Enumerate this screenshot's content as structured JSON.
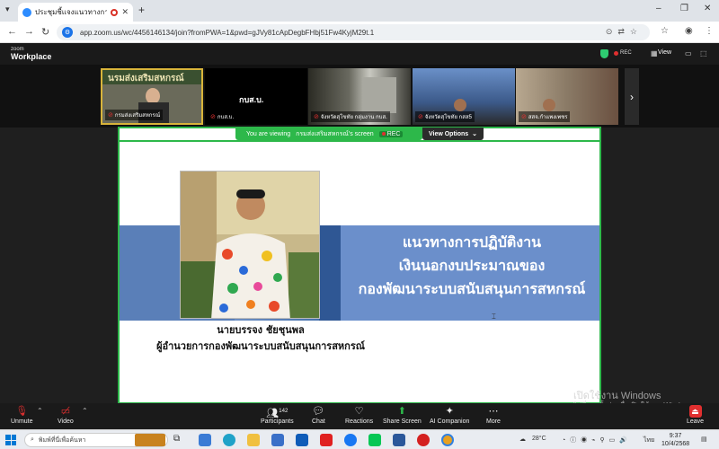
{
  "browser": {
    "tab_title": "ประชุมชี้แจงแนวทางการปฏิบัติงาน",
    "new_tab": "+",
    "url": "app.zoom.us/wc/4456146134/join?fromPWA=1&pwd=gJVy81cApDegbFHbj51Fw4KyjM29t.1"
  },
  "zoom_header": {
    "logo_top": "zoom",
    "logo_bottom": "Workplace",
    "rec_label": "REC",
    "view_label": "View"
  },
  "participants": [
    {
      "name": "กรมส่งเสริมสหกรณ์",
      "bg": "#6a6a5a"
    },
    {
      "name": "กบส.บ.",
      "bg": "#000000"
    },
    {
      "name": "จังหวัดสุโขทัย กลุ่มงาน กบส.",
      "bg": "#3a3a34"
    },
    {
      "name": "จังหวัดสุโขทัย กสส5",
      "bg": "#3c5a8a"
    },
    {
      "name": "สสจ.กำแพงเพชร",
      "bg": "#8a7a66"
    }
  ],
  "share_bar": {
    "prefix": "You are viewing",
    "sharer": "กรมส่งเสริมสหกรณ์'s screen",
    "rec_label": "REC",
    "view_options": "View Options"
  },
  "slide": {
    "title_lines": [
      "แนวทางการปฏิบัติงาน",
      "เงินนอกงบประมาณของ",
      "กองพัฒนาระบบสนับสนุนการสหกรณ์"
    ],
    "person_name": "นายบรรจง ชัยชุนพล",
    "person_position": "ผู้อำนวยการกองพัฒนาระบบสนับสนุนการสหกรณ์",
    "photo_banner": "นรมส่งเสริมสหกรณ์"
  },
  "controls": {
    "unmute": "Unmute",
    "video": "Video",
    "participants": "Participants",
    "participants_count": "142",
    "chat": "Chat",
    "reactions": "Reactions",
    "share_screen": "Share Screen",
    "ai_companion": "AI Companion",
    "more": "More",
    "leave": "Leave"
  },
  "watermark": {
    "line1": "เปิดใช้งาน Windows",
    "line2": "ไปที่การตั้งค่า เพื่อเปิดใช้งาน Windows"
  },
  "taskbar": {
    "search_placeholder": "พิมพ์ที่นี่เพื่อค้นหา",
    "weather": "28°C",
    "lang": "ไทย",
    "time": "9:37",
    "date": "10/4/2568"
  }
}
